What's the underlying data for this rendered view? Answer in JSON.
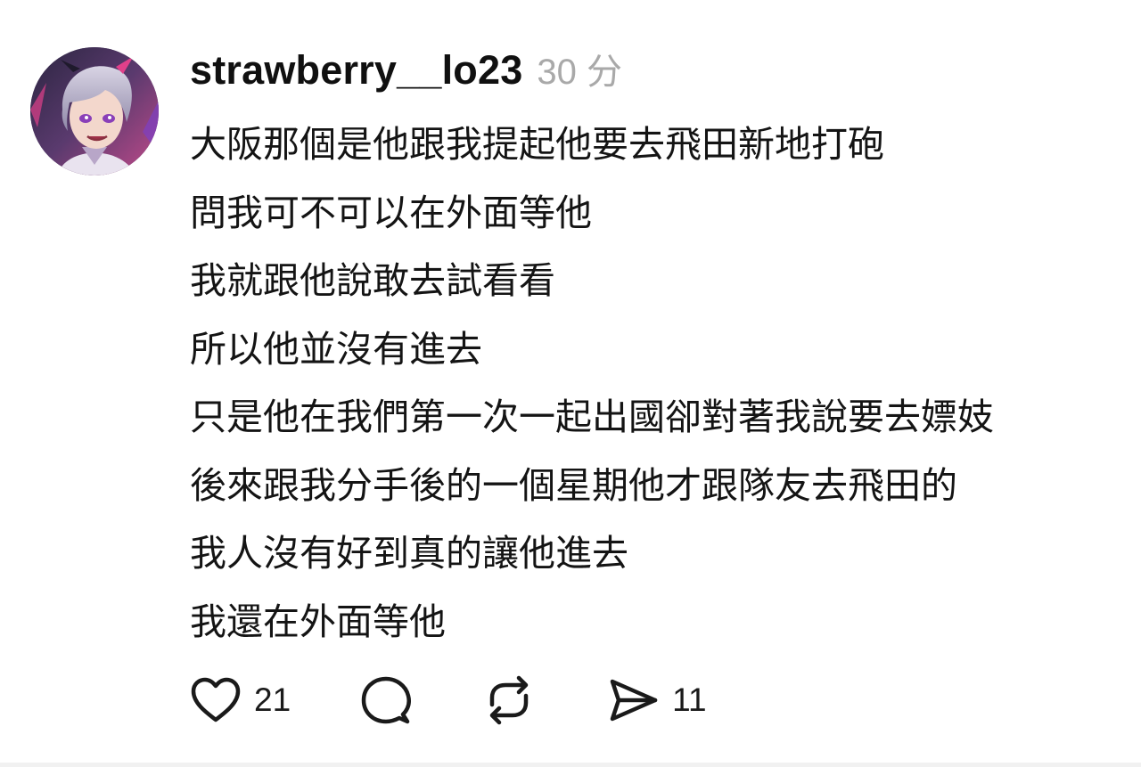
{
  "post": {
    "username": "strawberry__lo23",
    "time": "30 分",
    "lines": [
      "大阪那個是他跟我提起他要去飛田新地打砲",
      "問我可不可以在外面等他",
      "我就跟他說敢去試看看",
      "所以他並沒有進去",
      "只是他在我們第一次一起出國卻對著我說要去嫖妓",
      "後來跟我分手後的一個星期他才跟隊友去飛田的",
      "我人沒有好到真的讓他進去",
      "我還在外面等他"
    ]
  },
  "actions": {
    "like": {
      "icon": "heart-icon",
      "count": "21"
    },
    "comment": {
      "icon": "comment-bubble-icon"
    },
    "repost": {
      "icon": "repost-icon"
    },
    "share": {
      "icon": "send-icon",
      "count": "11"
    }
  },
  "colors": {
    "text": "#101010",
    "timestamp": "#a9a9a9",
    "background": "#ffffff"
  }
}
